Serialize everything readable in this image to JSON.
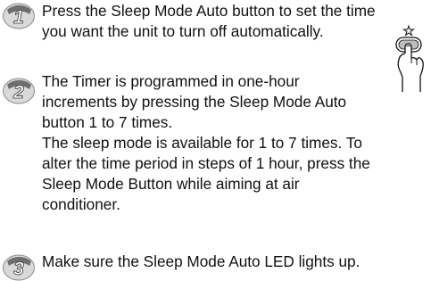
{
  "steps": [
    {
      "number": "1",
      "paragraphs": [
        "Press the Sleep Mode Auto button to set the time\nyou want the unit to turn off automatically."
      ]
    },
    {
      "number": "2",
      "paragraphs": [
        "The Timer is programmed in one-hour\nincrements by pressing the Sleep Mode Auto\nbutton 1 to 7 times.",
        "The sleep mode is available for 1 to 7 times. To\nalter the time period in steps of 1 hour, press the\nSleep Mode Button while aiming at air\nconditioner."
      ]
    },
    {
      "number": "3",
      "paragraphs": [
        "Make sure the Sleep Mode Auto LED lights up."
      ]
    }
  ],
  "illustration": {
    "icon": "hand-pressing-button-icon"
  },
  "colors": {
    "badge_fill": "#6e6e6e",
    "badge_highlight": "#d9d9d9",
    "badge_number": "#ffffff",
    "text": "#111111"
  }
}
